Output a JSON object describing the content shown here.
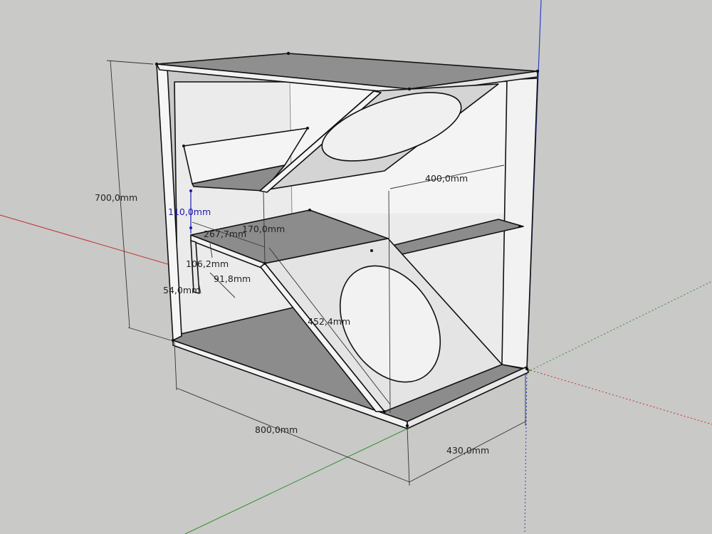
{
  "colors": {
    "background": "#c9c9c7",
    "panel_light": "#f2f2f2",
    "panel_mid": "#d4d4d4",
    "panel_dark": "#8c8c8c",
    "edge": "#111111",
    "axis_red": "#c0302c",
    "axis_green": "#2f8f2f",
    "axis_blue": "#2f40c8",
    "dimension_active": "#1a1ab0"
  },
  "dimensions": {
    "height": "700,0mm",
    "depth_width": "800,0mm",
    "width": "430,0mm",
    "port_length": "400,0mm",
    "slot_gap": "110,0mm",
    "vertical_gap": "170,0mm",
    "shelf_depth": "267,7mm",
    "offset_a": "106,2mm",
    "offset_b": "91,8mm",
    "offset_c": "54,0mm",
    "diagonal": "452,4mm"
  }
}
